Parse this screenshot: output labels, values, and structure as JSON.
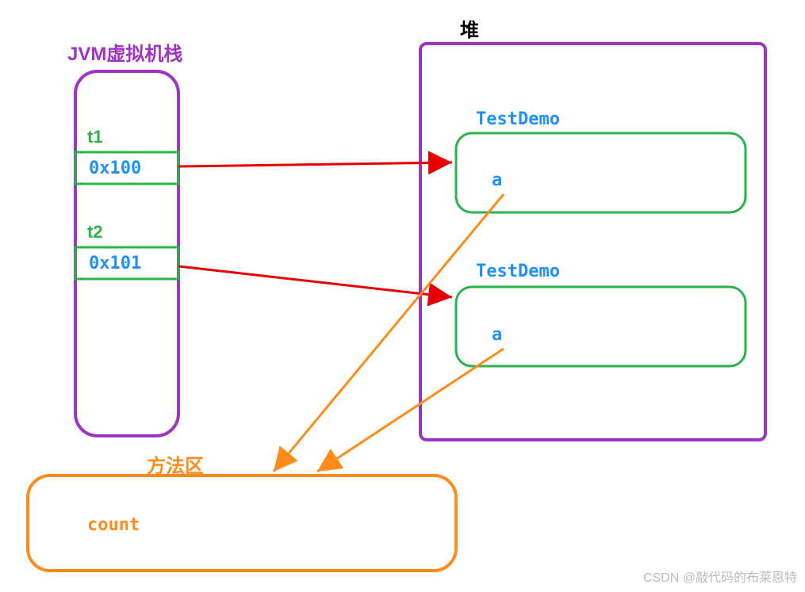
{
  "stack": {
    "title": "JVM虚拟机栈",
    "t1": {
      "label": "t1",
      "value": "0x100"
    },
    "t2": {
      "label": "t2",
      "value": "0x101"
    }
  },
  "heap": {
    "title": "堆",
    "obj1": {
      "class": "TestDemo",
      "field": "a"
    },
    "obj2": {
      "class": "TestDemo",
      "field": "a"
    }
  },
  "methodArea": {
    "title": "方法区",
    "field": "count"
  },
  "watermark": "CSDN @敲代码的布莱恩特"
}
